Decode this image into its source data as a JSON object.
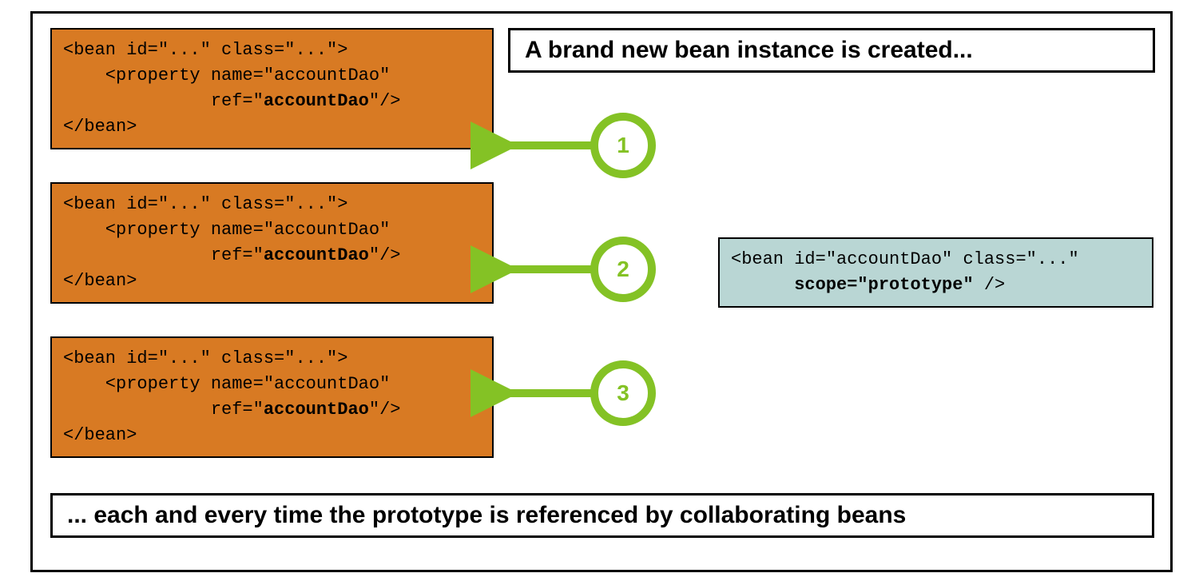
{
  "title_top": "A brand new bean instance is created...",
  "title_bottom": "... each and every time the prototype is referenced by collaborating beans",
  "bean_box": {
    "line1": "<bean id=\"...\" class=\"...\">",
    "line2": "    <property name=\"accountDao\"",
    "line3_prefix": "              ref=\"",
    "line3_bold": "accountDao",
    "line3_suffix": "\"/>",
    "line4": "</bean>"
  },
  "proto_box": {
    "line1": "<bean id=\"accountDao\" class=\"...\"",
    "line2_prefix": "      ",
    "line2_bold": "scope=\"prototype\"",
    "line2_suffix": " />"
  },
  "numbers": {
    "n1": "1",
    "n2": "2",
    "n3": "3"
  },
  "colors": {
    "orange": "#d87a23",
    "teal": "#b9d6d4",
    "green": "#84c225"
  }
}
